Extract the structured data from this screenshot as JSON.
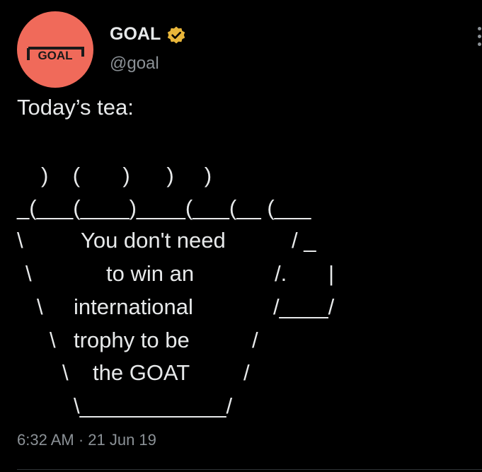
{
  "author": {
    "display_name": "GOAL",
    "handle": "@goal",
    "avatar_text": "GOAL",
    "avatar_color": "#f06a5a",
    "verified_color": "#e8b63a",
    "icons": [
      "goal-logo-icon",
      "verified-badge-icon",
      "more-options-icon"
    ]
  },
  "tweet": {
    "text": "Today’s tea:",
    "art": {
      "steam": ")    (       )      )     )",
      "rim": "_(___(____)____(___(__ (___",
      "row1": {
        "left": "\\",
        "text": "You don't need",
        "right": "/ _"
      },
      "row2": {
        "left": "\\",
        "text": "to win an",
        "right": "/.",
        "handle": "|"
      },
      "row3": {
        "left": "\\",
        "text": "international",
        "right": "/____/"
      },
      "row4": {
        "left": "\\",
        "text": "trophy to be",
        "right": "/"
      },
      "row5": {
        "left": "\\",
        "text": "the GOAT",
        "right": "/"
      },
      "base": "\\____________/"
    },
    "timestamp": "6:32 AM · 21 Jun 19"
  }
}
